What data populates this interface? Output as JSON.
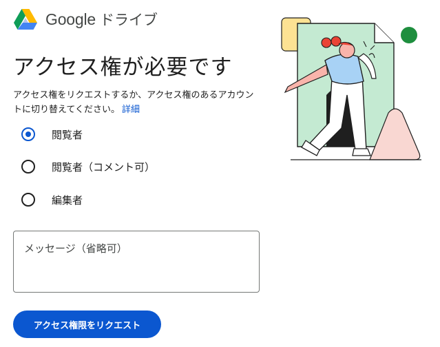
{
  "header": {
    "logo_icon": "google-drive-logo",
    "brand_google": "Google",
    "brand_product": "ドライブ"
  },
  "main": {
    "title": "アクセス権が必要です",
    "description": "アクセス権をリクエストするか、アクセス権のあるアカウントに切り替えてください。",
    "details_link": "詳細"
  },
  "roles": [
    {
      "label": "閲覧者",
      "selected": true
    },
    {
      "label": "閲覧者（コメント可）",
      "selected": false
    },
    {
      "label": "編集者",
      "selected": false
    }
  ],
  "message": {
    "placeholder": "メッセージ（省略可）",
    "value": ""
  },
  "actions": {
    "request_label": "アクセス権限をリクエスト"
  },
  "colors": {
    "accent": "#0b57d0",
    "illustration_green": "#c4ead2",
    "illustration_peach": "#f9d7d2",
    "illustration_yellow": "#fde293",
    "illustration_dot": "#1e8e3e",
    "illustration_hair": "#ea4335",
    "illustration_shirt": "#a8d2f5"
  },
  "illustration": {
    "icon": "person-stepping-through-document-illustration"
  }
}
